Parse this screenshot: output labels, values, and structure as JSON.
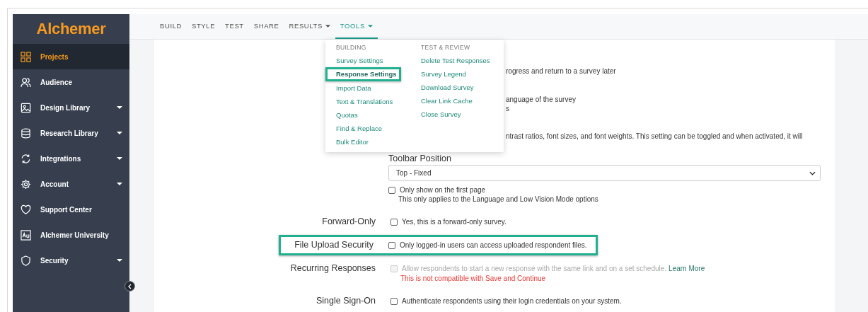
{
  "sidebar": {
    "logo": "Alchemer",
    "items": [
      {
        "label": "Projects",
        "selected": true,
        "submenu": false
      },
      {
        "label": "Audience",
        "selected": false,
        "submenu": false
      },
      {
        "label": "Design Library",
        "selected": false,
        "submenu": true
      },
      {
        "label": "Research Library",
        "selected": false,
        "submenu": true
      },
      {
        "label": "Integrations",
        "selected": false,
        "submenu": true
      },
      {
        "label": "Account",
        "selected": false,
        "submenu": true
      },
      {
        "label": "Support Center",
        "selected": false,
        "submenu": false
      },
      {
        "label": "Alchemer University",
        "selected": false,
        "submenu": false
      },
      {
        "label": "Security",
        "selected": false,
        "submenu": true
      }
    ]
  },
  "nav": {
    "tabs": [
      {
        "label": "BUILD",
        "selected": false,
        "dropdown": false
      },
      {
        "label": "STYLE",
        "selected": false,
        "dropdown": false
      },
      {
        "label": "TEST",
        "selected": false,
        "dropdown": false
      },
      {
        "label": "SHARE",
        "selected": false,
        "dropdown": false
      },
      {
        "label": "RESULTS",
        "selected": false,
        "dropdown": true
      },
      {
        "label": "TOOLS",
        "selected": true,
        "dropdown": true
      }
    ]
  },
  "tools_menu": {
    "columns": [
      {
        "heading": "BUILDING",
        "items": [
          {
            "label": "Survey Settings",
            "highlighted": false
          },
          {
            "label": "Response Settings",
            "highlighted": true
          },
          {
            "label": "Import Data",
            "highlighted": false
          },
          {
            "label": "Text & Translations",
            "highlighted": false
          },
          {
            "label": "Quotas",
            "highlighted": false
          },
          {
            "label": "Find & Replace",
            "highlighted": false
          },
          {
            "label": "Bulk Editor",
            "highlighted": false
          }
        ]
      },
      {
        "heading": "TEST & REVIEW",
        "items": [
          {
            "label": "Delete Test Responses",
            "highlighted": false
          },
          {
            "label": "Survey Legend",
            "highlighted": false
          },
          {
            "label": "Download Survey",
            "highlighted": false
          },
          {
            "label": "Clear Link Cache",
            "highlighted": false
          },
          {
            "label": "Close Survey",
            "highlighted": false
          }
        ]
      }
    ]
  },
  "settings": {
    "partial_texts": [
      "rogress and return to a survey later",
      "anguage of the survey",
      "s",
      "ntrast ratios, font sizes, and font weights. This setting can be toggled and when activated, it will"
    ],
    "toolbar_position": {
      "label": "Toolbar Position",
      "value": "Top - Fixed",
      "option": {
        "text": "Only show on the first page",
        "checked": false,
        "hint": "This only applies to the Language and Low Vision Mode options"
      }
    },
    "rows": [
      {
        "label": "Forward-Only",
        "text": "Yes, this is a forward-only survey.",
        "checked": false,
        "disabled": false,
        "highlighted": false
      },
      {
        "label": "File Upload Security",
        "text": "Only logged-in users can access uploaded respondent files.",
        "checked": false,
        "disabled": false,
        "highlighted": true
      },
      {
        "label": "Recurring Responses",
        "text": "Allow respondents to start a new response with the same link and on a set schedule.",
        "link": "Learn More",
        "note": "This is not compatible with Save and Continue",
        "checked": false,
        "disabled": true,
        "highlighted": false
      },
      {
        "label": "Single Sign-On",
        "text": "Authenticate respondents using their login credentials on your system.",
        "checked": false,
        "disabled": false,
        "highlighted": false
      }
    ]
  }
}
